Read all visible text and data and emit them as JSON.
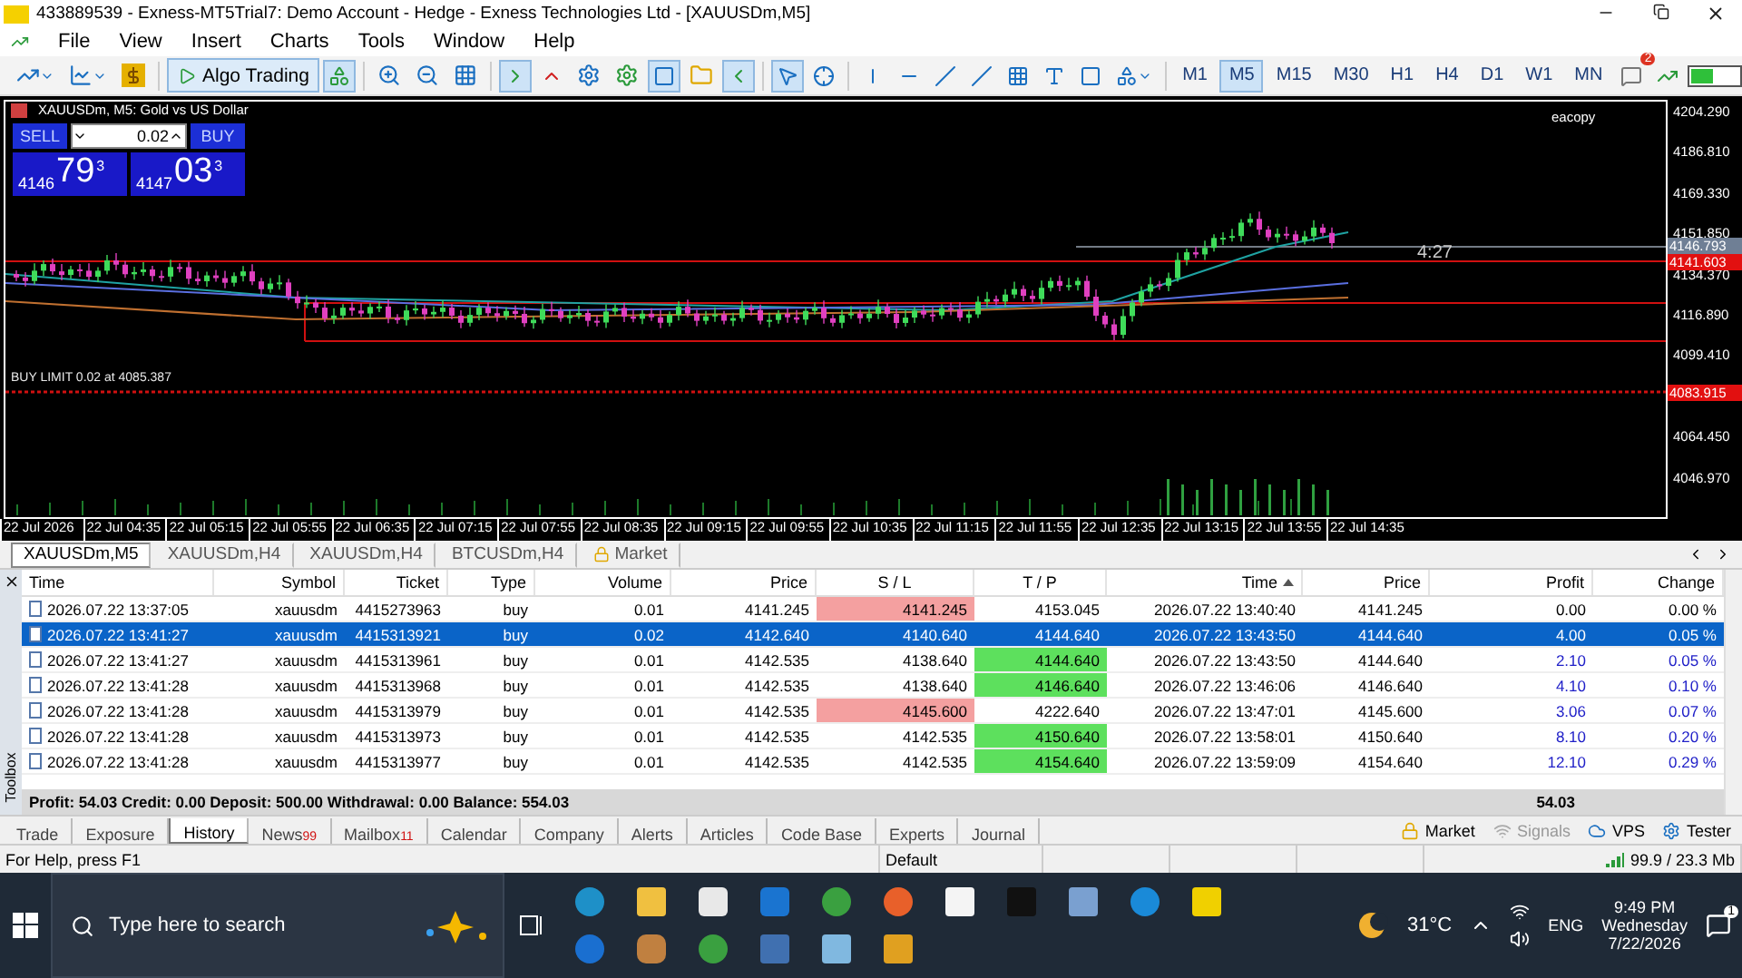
{
  "window": {
    "title": "433889539 - Exness-MT5Trial7: Demo Account - Hedge - Exness Technologies Ltd - [XAUUSDm,M5]"
  },
  "menu": [
    "File",
    "View",
    "Insert",
    "Charts",
    "Tools",
    "Window",
    "Help"
  ],
  "toolbar": {
    "algo_trading": "Algo Trading",
    "notification_count": "2",
    "timeframes": [
      {
        "label": "M1",
        "selected": false
      },
      {
        "label": "M5",
        "selected": true
      },
      {
        "label": "M15",
        "selected": false
      },
      {
        "label": "M30",
        "selected": false
      },
      {
        "label": "H1",
        "selected": false
      },
      {
        "label": "H4",
        "selected": false
      },
      {
        "label": "D1",
        "selected": false
      },
      {
        "label": "W1",
        "selected": false
      },
      {
        "label": "MN",
        "selected": false
      }
    ]
  },
  "chart": {
    "title": "XAUUSDm, M5:  Gold vs US Dollar",
    "expert": "eacopy",
    "timer": "4:27",
    "order_label": "BUY LIMIT 0.02 at 4085.387",
    "trade_panel": {
      "sell": "SELL",
      "buy": "BUY",
      "lot": "0.02",
      "bid": {
        "big": "4146",
        "pips": "79",
        "frac": "3"
      },
      "ask": {
        "big": "4147",
        "pips": "03",
        "frac": "3"
      }
    },
    "price_ticks": [
      "4204.290",
      "4186.810",
      "4169.330",
      "4151.850",
      "4134.370",
      "4116.890",
      "4099.410",
      "4064.450",
      "4046.970"
    ],
    "price_labels": [
      {
        "text": "4146.793",
        "kind": "bid"
      },
      {
        "text": "4141.603",
        "kind": "order"
      },
      {
        "text": "4083.915",
        "kind": "order"
      }
    ],
    "time_labels": [
      "22 Jul 2026",
      "22 Jul 04:35",
      "22 Jul 05:15",
      "22 Jul 05:55",
      "22 Jul 06:35",
      "22 Jul 07:15",
      "22 Jul 07:55",
      "22 Jul 08:35",
      "22 Jul 09:15",
      "22 Jul 09:55",
      "22 Jul 10:35",
      "22 Jul 11:15",
      "22 Jul 11:55",
      "22 Jul 12:35",
      "22 Jul 13:15",
      "22 Jul 13:55",
      "22 Jul 14:35"
    ]
  },
  "chart_tabs": [
    {
      "label": "XAUUSDm,M5",
      "selected": true,
      "kind": "chart"
    },
    {
      "label": "XAUUSDm,H4",
      "selected": false,
      "kind": "chart"
    },
    {
      "label": "XAUUSDm,H4",
      "selected": false,
      "kind": "chart"
    },
    {
      "label": "BTCUSDm,H4",
      "selected": false,
      "kind": "chart"
    },
    {
      "label": "Market",
      "selected": false,
      "kind": "locked"
    }
  ],
  "history": {
    "columns": [
      {
        "label": "Time",
        "sorted": false
      },
      {
        "label": "Symbol",
        "sorted": false
      },
      {
        "label": "Ticket",
        "sorted": false
      },
      {
        "label": "Type",
        "sorted": false
      },
      {
        "label": "Volume",
        "sorted": false
      },
      {
        "label": "Price",
        "sorted": false
      },
      {
        "label": "S / L",
        "sorted": false
      },
      {
        "label": "T / P",
        "sorted": false
      },
      {
        "label": "Time",
        "sorted": true
      },
      {
        "label": "Price",
        "sorted": false
      },
      {
        "label": "Profit",
        "sorted": false
      },
      {
        "label": "Change",
        "sorted": false
      }
    ],
    "rows": [
      {
        "selected": false,
        "sl_hit": true,
        "tp_hit": false,
        "positive": false,
        "cells": [
          "2026.07.22 13:37:05",
          "xauusdm",
          "4415273963",
          "buy",
          "0.01",
          "4141.245",
          "4141.245",
          "4153.045",
          "2026.07.22 13:40:40",
          "4141.245",
          "0.00",
          "0.00 %"
        ]
      },
      {
        "selected": true,
        "sl_hit": false,
        "tp_hit": false,
        "positive": true,
        "cells": [
          "2026.07.22 13:41:27",
          "xauusdm",
          "4415313921",
          "buy",
          "0.02",
          "4142.640",
          "4140.640",
          "4144.640",
          "2026.07.22 13:43:50",
          "4144.640",
          "4.00",
          "0.05 %"
        ]
      },
      {
        "selected": false,
        "sl_hit": false,
        "tp_hit": true,
        "positive": true,
        "cells": [
          "2026.07.22 13:41:27",
          "xauusdm",
          "4415313961",
          "buy",
          "0.01",
          "4142.535",
          "4138.640",
          "4144.640",
          "2026.07.22 13:43:50",
          "4144.640",
          "2.10",
          "0.05 %"
        ]
      },
      {
        "selected": false,
        "sl_hit": false,
        "tp_hit": true,
        "positive": true,
        "cells": [
          "2026.07.22 13:41:28",
          "xauusdm",
          "4415313968",
          "buy",
          "0.01",
          "4142.535",
          "4138.640",
          "4146.640",
          "2026.07.22 13:46:06",
          "4146.640",
          "4.10",
          "0.10 %"
        ]
      },
      {
        "selected": false,
        "sl_hit": true,
        "tp_hit": false,
        "positive": true,
        "cells": [
          "2026.07.22 13:41:28",
          "xauusdm",
          "4415313979",
          "buy",
          "0.01",
          "4142.535",
          "4145.600",
          "4222.640",
          "2026.07.22 13:47:01",
          "4145.600",
          "3.06",
          "0.07 %"
        ]
      },
      {
        "selected": false,
        "sl_hit": false,
        "tp_hit": true,
        "positive": true,
        "cells": [
          "2026.07.22 13:41:28",
          "xauusdm",
          "4415313973",
          "buy",
          "0.01",
          "4142.535",
          "4142.535",
          "4150.640",
          "2026.07.22 13:58:01",
          "4150.640",
          "8.10",
          "0.20 %"
        ]
      },
      {
        "selected": false,
        "sl_hit": false,
        "tp_hit": true,
        "positive": true,
        "cells": [
          "2026.07.22 13:41:28",
          "xauusdm",
          "4415313977",
          "buy",
          "0.01",
          "4142.535",
          "4142.535",
          "4154.640",
          "2026.07.22 13:59:09",
          "4154.640",
          "12.10",
          "0.29 %"
        ]
      }
    ],
    "summary": "Profit: 54.03  Credit: 0.00  Deposit: 500.00  Withdrawal: 0.00  Balance: 554.03",
    "summary_total": "54.03"
  },
  "toolbox_label": "Toolbox",
  "bottom_tabs": [
    {
      "label": "Trade",
      "selected": false
    },
    {
      "label": "Exposure",
      "selected": false
    },
    {
      "label": "History",
      "selected": true
    },
    {
      "label": "News",
      "selected": false,
      "badge": "99"
    },
    {
      "label": "Mailbox",
      "selected": false,
      "badge": "11"
    },
    {
      "label": "Calendar",
      "selected": false
    },
    {
      "label": "Company",
      "selected": false
    },
    {
      "label": "Alerts",
      "selected": false
    },
    {
      "label": "Articles",
      "selected": false
    },
    {
      "label": "Code Base",
      "selected": false
    },
    {
      "label": "Experts",
      "selected": false
    },
    {
      "label": "Journal",
      "selected": false
    }
  ],
  "bottom_links": [
    {
      "label": "Market",
      "disabled": false,
      "kind": "lock"
    },
    {
      "label": "Signals",
      "disabled": true,
      "kind": "signal"
    },
    {
      "label": "VPS",
      "disabled": false,
      "kind": "cloud"
    },
    {
      "label": "Tester",
      "disabled": false,
      "kind": "gear"
    }
  ],
  "status_bar": {
    "help": "For Help, press F1",
    "profile": "Default",
    "connection": "99.9 / 23.3 Mb"
  },
  "taskbar": {
    "search_placeholder": "Type here to search",
    "temperature": "31°C",
    "language": "ENG",
    "time": "9:49 PM",
    "day": "Wednesday",
    "date": "7/22/2026",
    "notifications": "1"
  }
}
